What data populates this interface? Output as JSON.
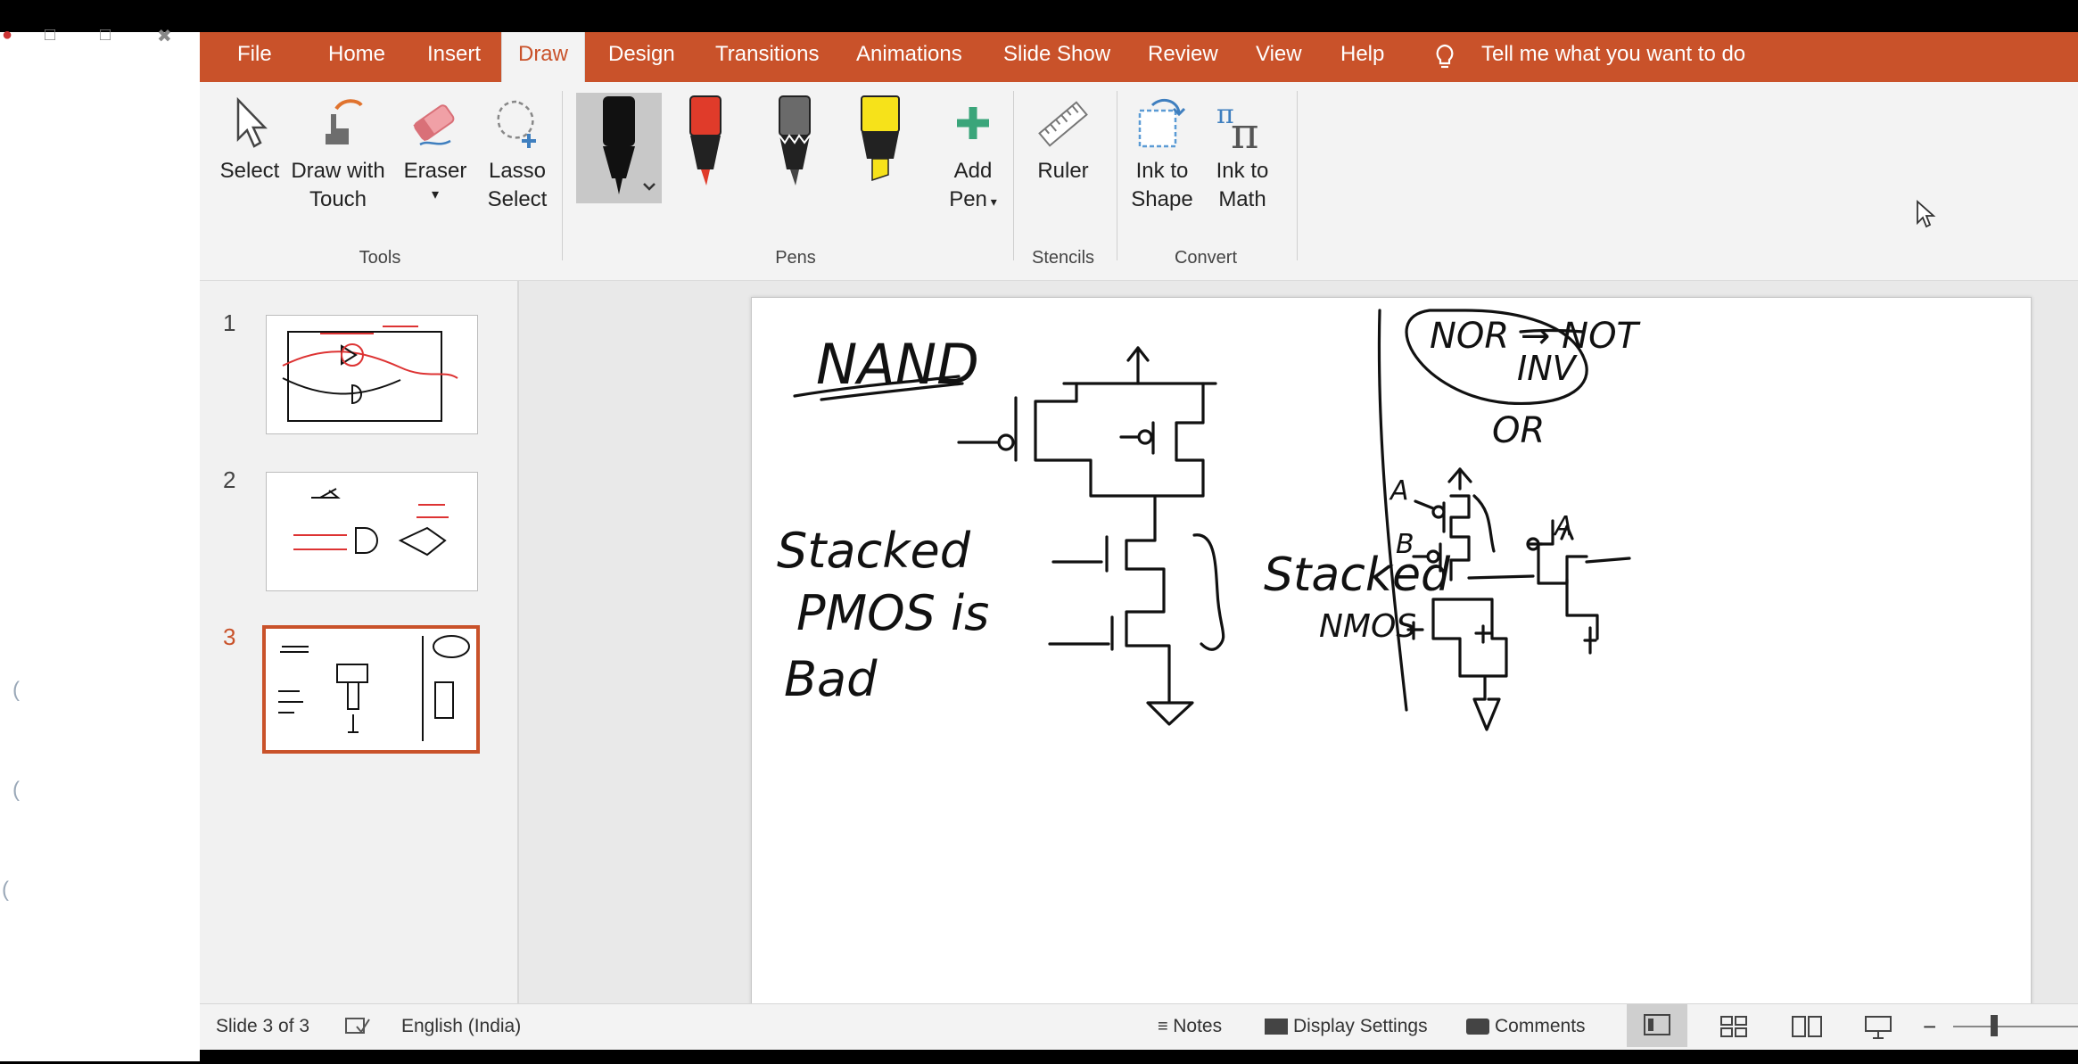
{
  "ribbon_tabs": {
    "file": "File",
    "home": "Home",
    "insert": "Insert",
    "draw": "Draw",
    "design": "Design",
    "transitions": "Transitions",
    "animations": "Animations",
    "slideshow": "Slide Show",
    "review": "Review",
    "view": "View",
    "help": "Help",
    "tell": "Tell me what you want to do"
  },
  "tools": {
    "select": "Select",
    "draw_touch_1": "Draw with",
    "draw_touch_2": "Touch",
    "eraser": "Eraser",
    "lasso_1": "Lasso",
    "lasso_2": "Select",
    "group": "Tools"
  },
  "pens": {
    "add_1": "Add",
    "add_2": "Pen",
    "group": "Pens",
    "colors": [
      "#111111",
      "#e03b2a",
      "#555555",
      "#f6e21a"
    ]
  },
  "stencils": {
    "ruler": "Ruler",
    "group": "Stencils"
  },
  "convert": {
    "ink_shape_1": "Ink to",
    "ink_shape_2": "Shape",
    "ink_math_1": "Ink to",
    "ink_math_2": "Math",
    "group": "Convert"
  },
  "thumbnails": [
    "1",
    "2",
    "3"
  ],
  "slide": {
    "nand": "NAND",
    "stacked_pmos_1": "Stacked",
    "stacked_pmos_2": "PMOS is",
    "stacked_pmos_3": "Bad",
    "stacked_nmos_1": "Stacked",
    "stacked_nmos_2": "NMOS",
    "nor": "NOR → NOT",
    "inv": "INV",
    "or": "OR",
    "a1": "A",
    "b1": "B",
    "a2": "A"
  },
  "status": {
    "slide": "Slide 3 of 3",
    "language": "English (India)",
    "notes": "Notes",
    "display": "Display Settings",
    "comments": "Comments"
  },
  "colors": {
    "accent": "#c9522a",
    "ink": "#111111"
  }
}
